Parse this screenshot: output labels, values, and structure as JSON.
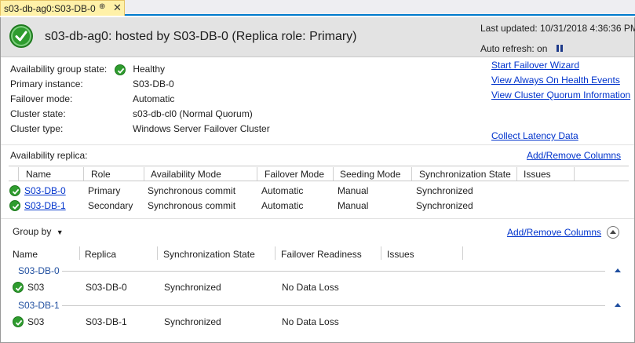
{
  "tab": {
    "title": "s03-db-ag0:S03-DB-0",
    "pin_glyph": "⊕",
    "close_glyph": "✕"
  },
  "header": {
    "title": "s03-db-ag0: hosted by S03-DB-0 (Replica role: Primary)",
    "last_updated": "Last updated: 10/31/2018 4:36:36 PM",
    "auto_refresh": "Auto refresh: on"
  },
  "summary": [
    {
      "label": "Availability group state:",
      "value": "Healthy"
    },
    {
      "label": "Primary instance:",
      "value": "S03-DB-0"
    },
    {
      "label": "Failover mode:",
      "value": "Automatic"
    },
    {
      "label": "Cluster state:",
      "value": "s03-db-cl0 (Normal Quorum)"
    },
    {
      "label": "Cluster type:",
      "value": "Windows Server Failover Cluster"
    }
  ],
  "links": {
    "start_failover": "Start Failover Wizard",
    "health_events": "View Always On Health Events",
    "cluster_quorum": "View Cluster Quorum Information",
    "collect_latency": "Collect Latency Data",
    "add_remove_columns": "Add/Remove Columns"
  },
  "replica_section": {
    "label": "Availability replica:",
    "columns": [
      "Name",
      "Role",
      "Availability Mode",
      "Failover Mode",
      "Seeding Mode",
      "Synchronization State",
      "Issues"
    ],
    "rows": [
      {
        "name": "S03-DB-0",
        "role": "Primary",
        "availability_mode": "Synchronous commit",
        "failover_mode": "Automatic",
        "seeding_mode": "Manual",
        "sync_state": "Synchronized",
        "issues": ""
      },
      {
        "name": "S03-DB-1",
        "role": "Secondary",
        "availability_mode": "Synchronous commit",
        "failover_mode": "Automatic",
        "seeding_mode": "Manual",
        "sync_state": "Synchronized",
        "issues": ""
      }
    ]
  },
  "database_section": {
    "group_by": "Group by",
    "columns": [
      "Name",
      "Replica",
      "Synchronization State",
      "Failover Readiness",
      "Issues"
    ],
    "groups": [
      {
        "header": "S03-DB-0",
        "rows": [
          {
            "name": "S03",
            "replica": "S03-DB-0",
            "sync_state": "Synchronized",
            "failover_readiness": "No Data Loss"
          }
        ]
      },
      {
        "header": "S03-DB-1",
        "rows": [
          {
            "name": "S03",
            "replica": "S03-DB-1",
            "sync_state": "Synchronized",
            "failover_readiness": "No Data Loss"
          }
        ]
      }
    ]
  },
  "colors": {
    "accent": "#007acc",
    "healthy": "#2e9c2e",
    "link": "#0033cc",
    "group_header": "#1f4e9f"
  }
}
